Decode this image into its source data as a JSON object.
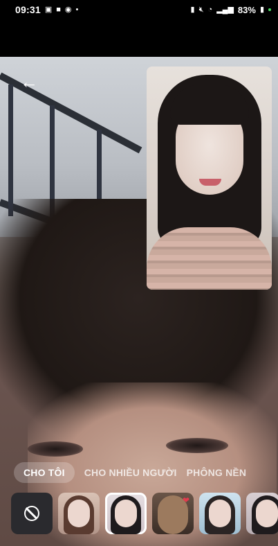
{
  "status_bar": {
    "time": "09:31",
    "left_icons": [
      "gallery-icon",
      "video-icon",
      "app-notification-icon",
      "dot-icon"
    ],
    "right_icons": [
      "battery-saver-icon",
      "mute-icon",
      "wifi-icon",
      "signal-icon"
    ],
    "battery_text": "83%"
  },
  "call": {
    "back_icon": "arrow-left-icon"
  },
  "effects": {
    "tabs": [
      {
        "label": "CHO TÔI",
        "active": true
      },
      {
        "label": "CHO NHIỀU NGƯỜI",
        "active": false
      },
      {
        "label": "PHÔNG NỀN",
        "active": false
      }
    ],
    "no_effect_icon": "block-icon",
    "thumbnails": [
      {
        "name": "effect-thumb-1",
        "selected": false
      },
      {
        "name": "effect-thumb-2",
        "selected": true
      },
      {
        "name": "effect-thumb-3",
        "selected": false
      },
      {
        "name": "effect-thumb-4",
        "selected": false
      },
      {
        "name": "effect-thumb-5",
        "selected": false
      }
    ]
  },
  "colors": {
    "tab_active_bg": "#ffffff38",
    "status_bar_bg": "#000000"
  }
}
